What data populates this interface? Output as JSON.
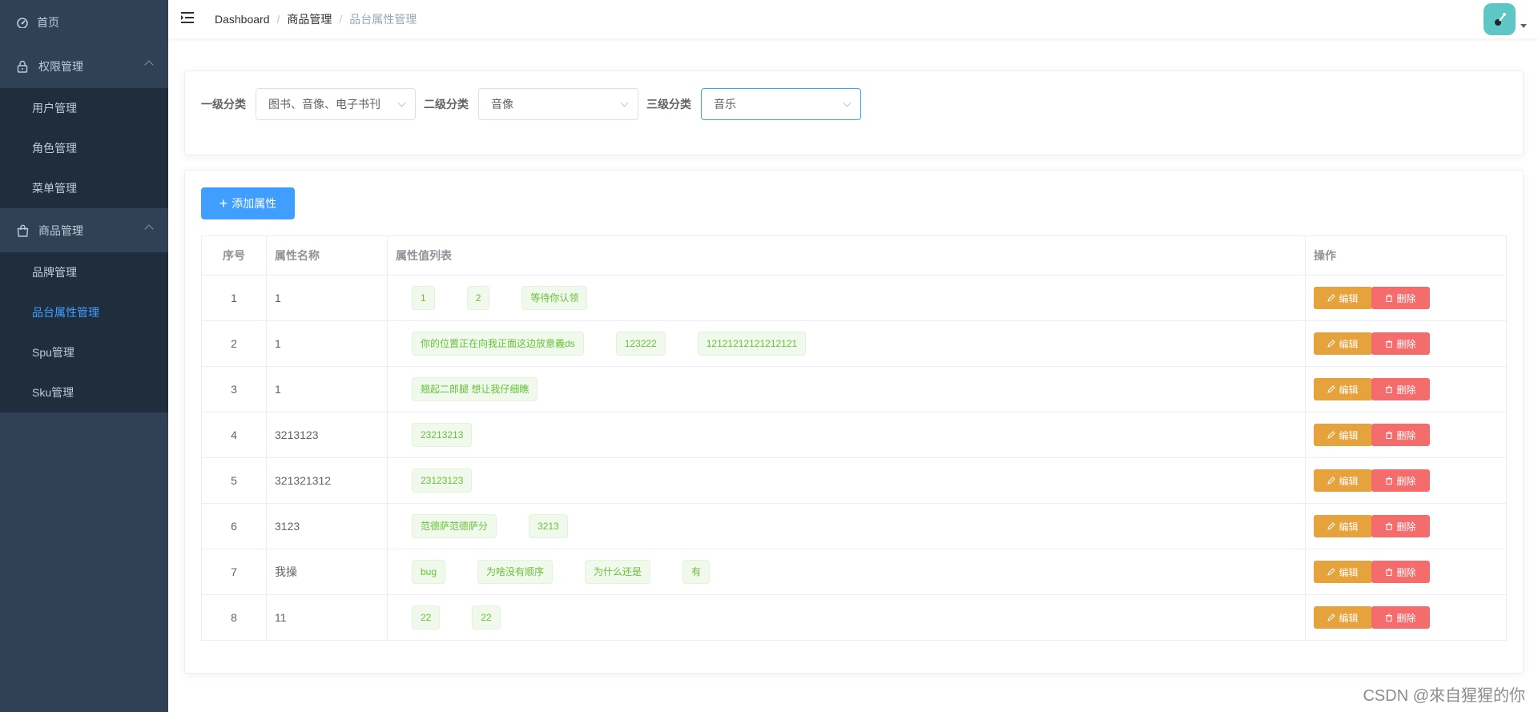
{
  "sidebar": {
    "home": {
      "label": "首页",
      "icon": "dashboard-icon"
    },
    "groups": [
      {
        "label": "权限管理",
        "icon": "lock-icon",
        "items": [
          "用户管理",
          "角色管理",
          "菜单管理"
        ]
      },
      {
        "label": "商品管理",
        "icon": "shopping-bag-icon",
        "items": [
          "品牌管理",
          "品台属性管理",
          "Spu管理",
          "Sku管理"
        ]
      }
    ],
    "active_item": "品台属性管理"
  },
  "navbar": {
    "breadcrumb": [
      "Dashboard",
      "商品管理",
      "品台属性管理"
    ],
    "separator": "/"
  },
  "filter": {
    "labels": [
      "一级分类",
      "二级分类",
      "三级分类"
    ],
    "values": [
      "图书、音像、电子书刊",
      "音像",
      "音乐"
    ]
  },
  "toolbar": {
    "add_label": "添加属性"
  },
  "table": {
    "headers": [
      "序号",
      "属性名称",
      "属性值列表",
      "操作"
    ],
    "rows": [
      {
        "idx": "1",
        "name": "1",
        "values": [
          "1",
          "2",
          "等待你认领"
        ]
      },
      {
        "idx": "2",
        "name": "1",
        "values": [
          "你的位置正在向我正面这边放意義ds",
          "123222",
          "12121212121212121"
        ]
      },
      {
        "idx": "3",
        "name": "1",
        "values": [
          "翘起二郎腿 想让我仔细瞧"
        ]
      },
      {
        "idx": "4",
        "name": "3213123",
        "values": [
          "23213213"
        ]
      },
      {
        "idx": "5",
        "name": "321321312",
        "values": [
          "23123123"
        ]
      },
      {
        "idx": "6",
        "name": "3123",
        "values": [
          "范德萨范德萨分",
          "3213"
        ]
      },
      {
        "idx": "7",
        "name": "我操",
        "values": [
          "bug",
          "为啥没有顺序",
          "为什么还是",
          "有"
        ]
      },
      {
        "idx": "8",
        "name": "11",
        "values": [
          "22",
          "22"
        ]
      }
    ],
    "edit_label": "编辑",
    "delete_label": "删除"
  },
  "watermark": "CSDN @來自猩猩的你",
  "colors": {
    "sidebar_bg": "#304156",
    "submenu_bg": "#1f2d3d",
    "primary": "#409eff",
    "warning": "#e6a23c",
    "danger": "#f56c6c",
    "success": "#67c23a"
  }
}
